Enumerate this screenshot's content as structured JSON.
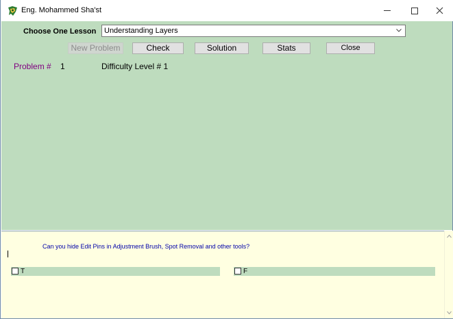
{
  "window": {
    "title": "Eng. Mohammed Sha'st",
    "app_icon": "app-icon"
  },
  "lesson": {
    "label": "Choose One Lesson",
    "selected": "Understanding Layers"
  },
  "toolbar": {
    "new_problem": "New Problem",
    "check": "Check",
    "solution": "Solution",
    "stats": "Stats",
    "close": "Close"
  },
  "problem": {
    "label": "Problem #",
    "number": "1",
    "difficulty_label": "Difficulty Level # 1"
  },
  "question": {
    "text": "Can you hide Edit Pins in Adjustment Brush, Spot Removal and other tools?",
    "options": [
      {
        "label": "T",
        "checked": false
      },
      {
        "label": "F",
        "checked": false
      }
    ]
  },
  "colors": {
    "panel_green": "#bedcbe",
    "question_bg": "#ffffe1",
    "question_text": "#0000a8",
    "problem_label": "#800080"
  }
}
